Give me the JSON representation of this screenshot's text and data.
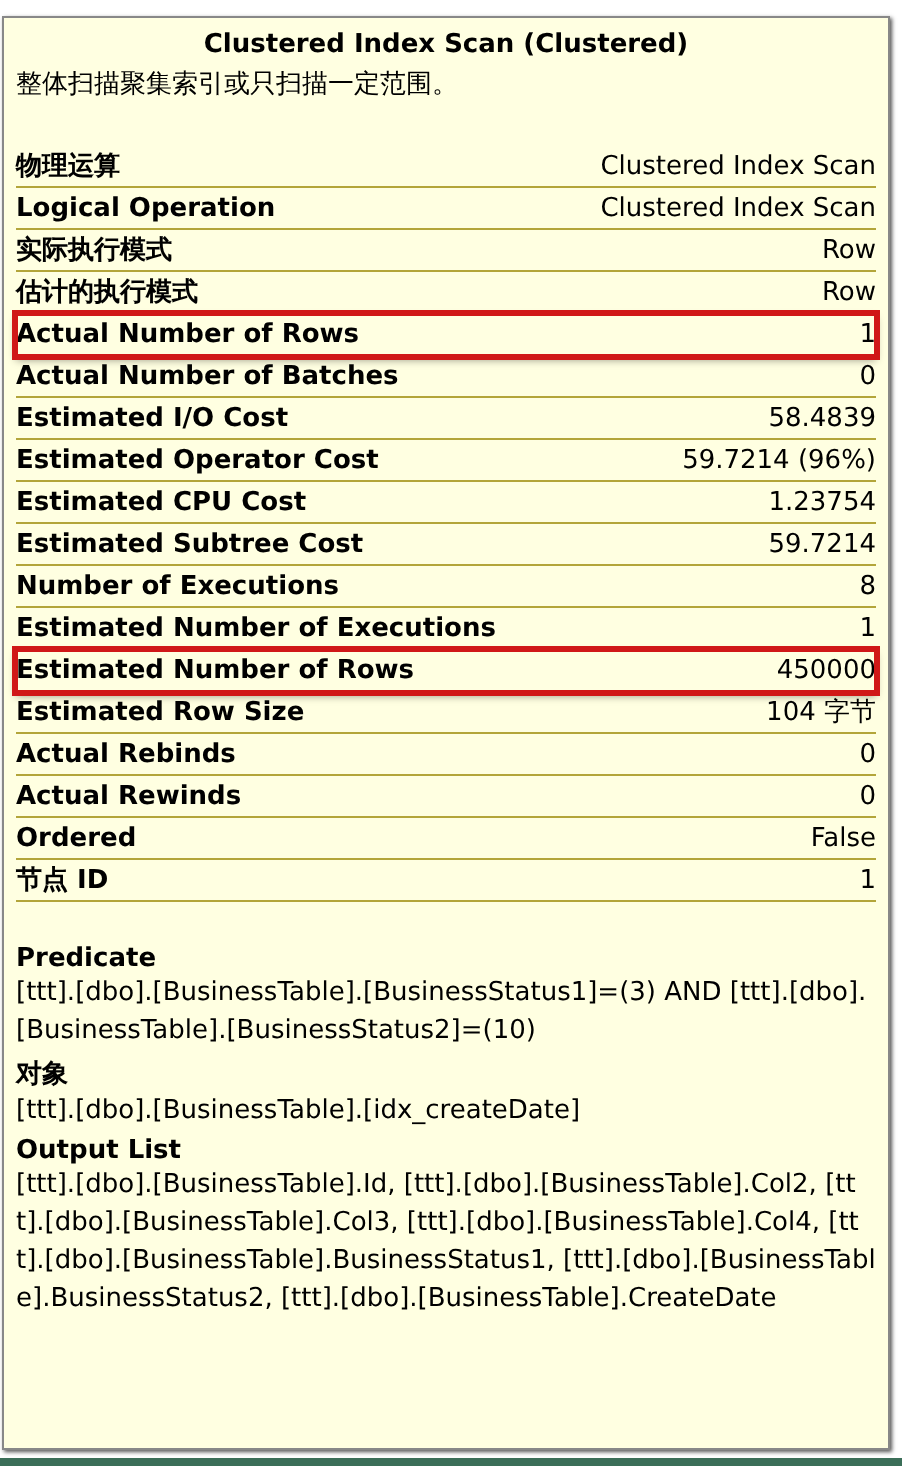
{
  "tooltip": {
    "title": "Clustered Index Scan (Clustered)",
    "description": "整体扫描聚集索引或只扫描一定范围。",
    "properties": [
      {
        "label": "物理运算",
        "value": "Clustered Index Scan",
        "highlighted": false
      },
      {
        "label": "Logical Operation",
        "value": "Clustered Index Scan",
        "highlighted": false
      },
      {
        "label": "实际执行模式",
        "value": "Row",
        "highlighted": false
      },
      {
        "label": "估计的执行模式",
        "value": "Row",
        "highlighted": false
      },
      {
        "label": "Actual Number of Rows",
        "value": "1",
        "highlighted": true
      },
      {
        "label": "Actual Number of Batches",
        "value": "0",
        "highlighted": false
      },
      {
        "label": "Estimated I/O Cost",
        "value": "58.4839",
        "highlighted": false
      },
      {
        "label": "Estimated Operator Cost",
        "value": "59.7214 (96%)",
        "highlighted": false
      },
      {
        "label": "Estimated CPU Cost",
        "value": "1.23754",
        "highlighted": false
      },
      {
        "label": "Estimated Subtree Cost",
        "value": "59.7214",
        "highlighted": false
      },
      {
        "label": "Number of Executions",
        "value": "8",
        "highlighted": false
      },
      {
        "label": "Estimated Number of Executions",
        "value": "1",
        "highlighted": false
      },
      {
        "label": "Estimated Number of Rows",
        "value": "450000",
        "highlighted": true
      },
      {
        "label": "Estimated Row Size",
        "value": "104 字节",
        "highlighted": false
      },
      {
        "label": "Actual Rebinds",
        "value": "0",
        "highlighted": false
      },
      {
        "label": "Actual Rewinds",
        "value": "0",
        "highlighted": false
      },
      {
        "label": "Ordered",
        "value": "False",
        "highlighted": false
      },
      {
        "label": "节点 ID",
        "value": "1",
        "highlighted": false
      }
    ],
    "sections": [
      {
        "heading": "Predicate",
        "text": "[ttt].[dbo].[BusinessTable].[BusinessStatus1]=(3) AND [ttt].[dbo].[BusinessTable].[BusinessStatus2]=(10)"
      },
      {
        "heading": "对象",
        "text": "[ttt].[dbo].[BusinessTable].[idx_createDate]"
      },
      {
        "heading": "Output List",
        "text": "[ttt].[dbo].[BusinessTable].Id, [ttt].[dbo].[BusinessTable].Col2, [ttt].[dbo].[BusinessTable].Col3, [ttt].[dbo].[BusinessTable].Col4, [ttt].[dbo].[BusinessTable].BusinessStatus1, [ttt].[dbo].[BusinessTable].BusinessStatus2, [ttt].[dbo].[BusinessTable].CreateDate"
      }
    ]
  }
}
